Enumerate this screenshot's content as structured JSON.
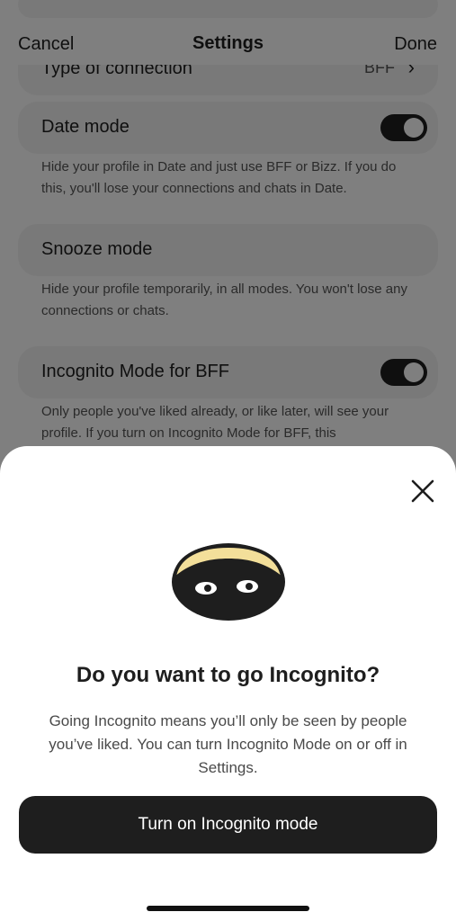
{
  "settings": {
    "nav": {
      "cancel": "Cancel",
      "title": "Settings",
      "done": "Done"
    },
    "partial_row": {
      "label": "Type of connection",
      "value": "BFF"
    },
    "date_mode": {
      "label": "Date mode",
      "toggle_on": true,
      "description": "Hide your profile in Date and just use BFF or Bizz. If you do this, you'll lose your connections and chats in Date."
    },
    "snooze_mode": {
      "label": "Snooze mode",
      "description": "Hide your profile temporarily, in all modes. You won't lose any connections or chats."
    },
    "incognito_bff": {
      "label": "Incognito Mode for BFF",
      "toggle_on": true,
      "description": "Only people you've liked already, or like later, will see your profile. If you turn on Incognito Mode for BFF, this"
    }
  },
  "sheet": {
    "close_icon": "close-icon",
    "illustration": "incognito-mask-icon",
    "title": "Do you want to go Incognito?",
    "body": "Going Incognito means you’ll only be seen by people you’ve liked. You can turn Incognito Mode on or off in Settings.",
    "cta": "Turn on Incognito mode"
  },
  "colors": {
    "primary": "#1e1e1e",
    "mask_hair": "#f3df9a",
    "card_bg": "#f2f2f2"
  }
}
